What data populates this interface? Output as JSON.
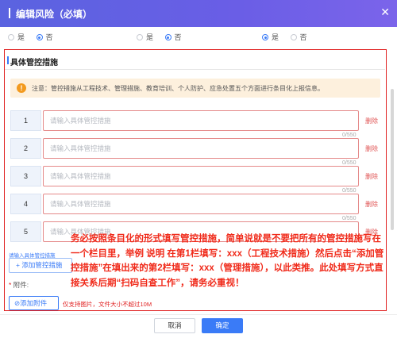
{
  "dialog": {
    "title": "编辑风险（必填）",
    "close_icon": "close-icon"
  },
  "radio_groups": [
    {
      "options": [
        {
          "label": "是",
          "selected": false
        },
        {
          "label": "否",
          "selected": true
        }
      ]
    },
    {
      "options": [
        {
          "label": "是",
          "selected": false
        },
        {
          "label": "否",
          "selected": true
        }
      ]
    },
    {
      "options": [
        {
          "label": "是",
          "selected": true
        },
        {
          "label": "否",
          "selected": false
        }
      ]
    }
  ],
  "section": {
    "title": "具体管控措施",
    "notice": "注意：管控措施从工程技术、管理措施、教育培训、个人防护、应急处置五个方面进行条目化上报信息。",
    "notice_icon": "warning-icon"
  },
  "measures": [
    {
      "index": "1",
      "placeholder": "请输入具体管控措施",
      "count": "0/550",
      "delete": "删除"
    },
    {
      "index": "2",
      "placeholder": "请输入具体管控措施",
      "count": "0/550",
      "delete": "删除"
    },
    {
      "index": "3",
      "placeholder": "请输入具体管控措施",
      "count": "0/550",
      "delete": "删除"
    },
    {
      "index": "4",
      "placeholder": "请输入具体管控措施",
      "count": "0/550",
      "delete": "删除"
    },
    {
      "index": "5",
      "placeholder": "请输入具体管控措施",
      "count": "0/550",
      "delete": "删除"
    }
  ],
  "hint": "请输入具体管控措施",
  "add_measure": "+ 添加管控措施",
  "attachment": {
    "star": "*",
    "label": "附件:",
    "button": "⊘添加附件",
    "note": "仅支持图片，文件大小不超过10M"
  },
  "overlay_text": "务必按照条目化的形式填写管控措施，简单说就是不要把所有的管控措施写在一个栏目里，举例 说明  在第1栏填写：xxx（工程技术措施）然后点击“添加管控措施”在填出来的第2栏填写：xxx（管理措施），以此类推。此处填写方式直接关系后期“扫码自查工作”，请务必重视！",
  "footer": {
    "cancel": "取消",
    "confirm": "确定"
  },
  "colors": {
    "accent": "#3a7bf7",
    "header": "#6a5ee6",
    "danger": "#e02020"
  }
}
